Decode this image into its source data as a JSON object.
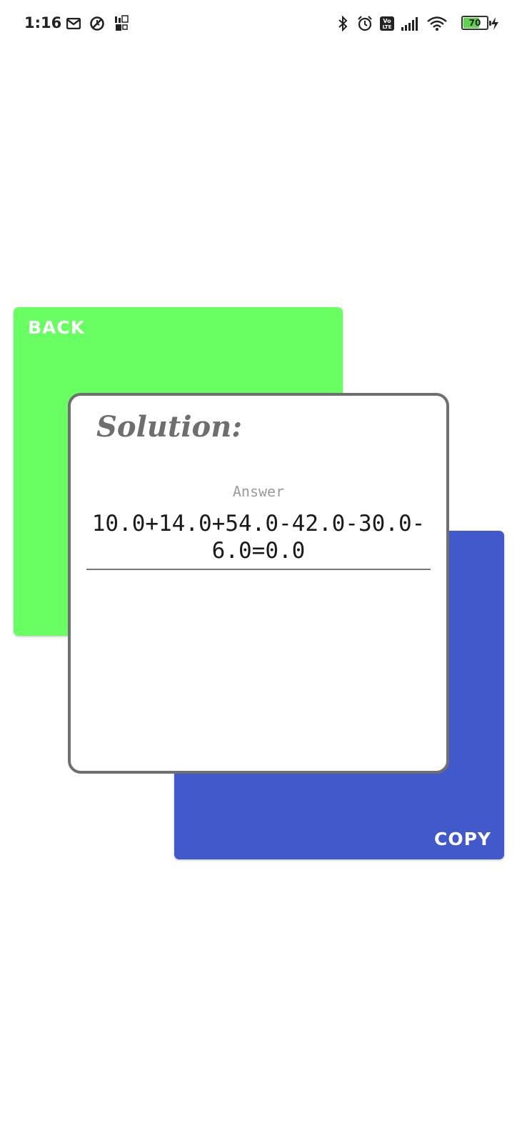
{
  "status_bar": {
    "time": "1:16",
    "battery_level": "70",
    "battery_fraction": 0.7,
    "icons": [
      "gmail-icon",
      "sync-off-icon",
      "info-network-icon",
      "bluetooth-icon",
      "alarm-icon",
      "volte-icon",
      "signal-icon",
      "wifi-icon",
      "battery-icon",
      "charging-icon"
    ]
  },
  "back_card": {
    "label": "BACK",
    "color": "#69ff62"
  },
  "copy_card": {
    "label": "COPY",
    "color": "#4259cc"
  },
  "solution": {
    "title": "Solution:",
    "answer_label": "Answer",
    "answer_value": "10.0+14.0+54.0-42.0-30.0-6.0=0.0"
  }
}
